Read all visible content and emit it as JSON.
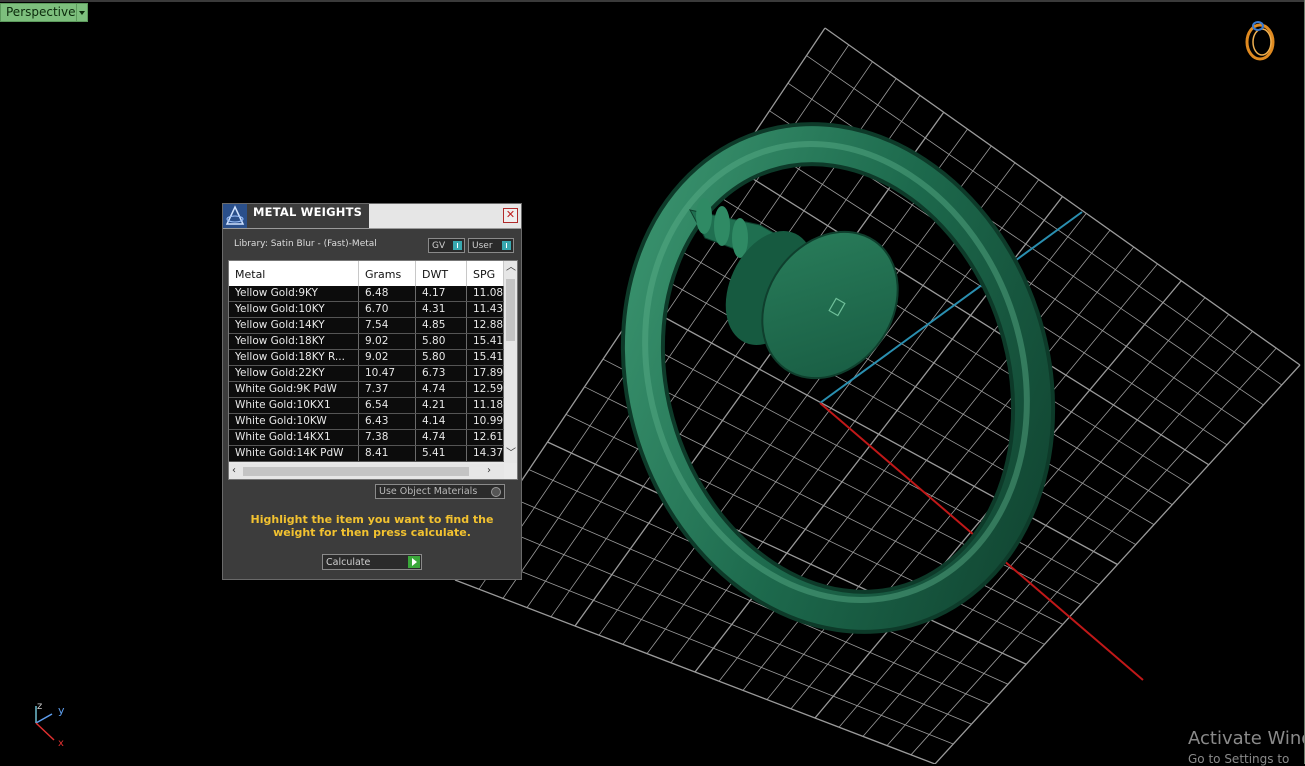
{
  "viewport": {
    "view_label": "Perspective",
    "axis_labels": {
      "z": "z",
      "y": "y",
      "x": "x"
    },
    "object_color": "#1e6b4e",
    "grid_color": "#9a9a9a",
    "axis_colors": {
      "x": "#c01818",
      "y": "#2a8fb0"
    },
    "gizmo_icon": "ring-view-gizmo-icon"
  },
  "watermark": {
    "line1": "Activate Wind",
    "line2": "Go to Settings to"
  },
  "panel": {
    "title": "METAL WEIGHTS",
    "library": "Library: Satin Blur - (Fast)-Metal",
    "toggles": {
      "gv": "GV",
      "user": "User"
    },
    "columns": [
      "Metal",
      "Grams",
      "DWT",
      "SPG"
    ],
    "rows": [
      {
        "metal": "Yellow Gold:9KY",
        "grams": "6.48",
        "dwt": "4.17",
        "spg": "11.08"
      },
      {
        "metal": "Yellow Gold:10KY",
        "grams": "6.70",
        "dwt": "4.31",
        "spg": "11.43"
      },
      {
        "metal": "Yellow Gold:14KY",
        "grams": "7.54",
        "dwt": "4.85",
        "spg": "12.88"
      },
      {
        "metal": "Yellow Gold:18KY",
        "grams": "9.02",
        "dwt": "5.80",
        "spg": "15.41"
      },
      {
        "metal": "Yellow Gold:18KY R...",
        "grams": "9.02",
        "dwt": "5.80",
        "spg": "15.41"
      },
      {
        "metal": "Yellow Gold:22KY",
        "grams": "10.47",
        "dwt": "6.73",
        "spg": "17.89"
      },
      {
        "metal": "White Gold:9K PdW",
        "grams": "7.37",
        "dwt": "4.74",
        "spg": "12.59"
      },
      {
        "metal": "White Gold:10KX1",
        "grams": "6.54",
        "dwt": "4.21",
        "spg": "11.18"
      },
      {
        "metal": "White Gold:10KW",
        "grams": "6.43",
        "dwt": "4.14",
        "spg": "10.99"
      },
      {
        "metal": "White Gold:14KX1",
        "grams": "7.38",
        "dwt": "4.74",
        "spg": "12.61"
      },
      {
        "metal": "White Gold:14K PdW",
        "grams": "8.41",
        "dwt": "5.41",
        "spg": "14.37"
      }
    ],
    "use_object_materials": "Use Object Materials",
    "hint": "Highlight the item you want to find the weight for then press calculate.",
    "calculate": "Calculate"
  }
}
